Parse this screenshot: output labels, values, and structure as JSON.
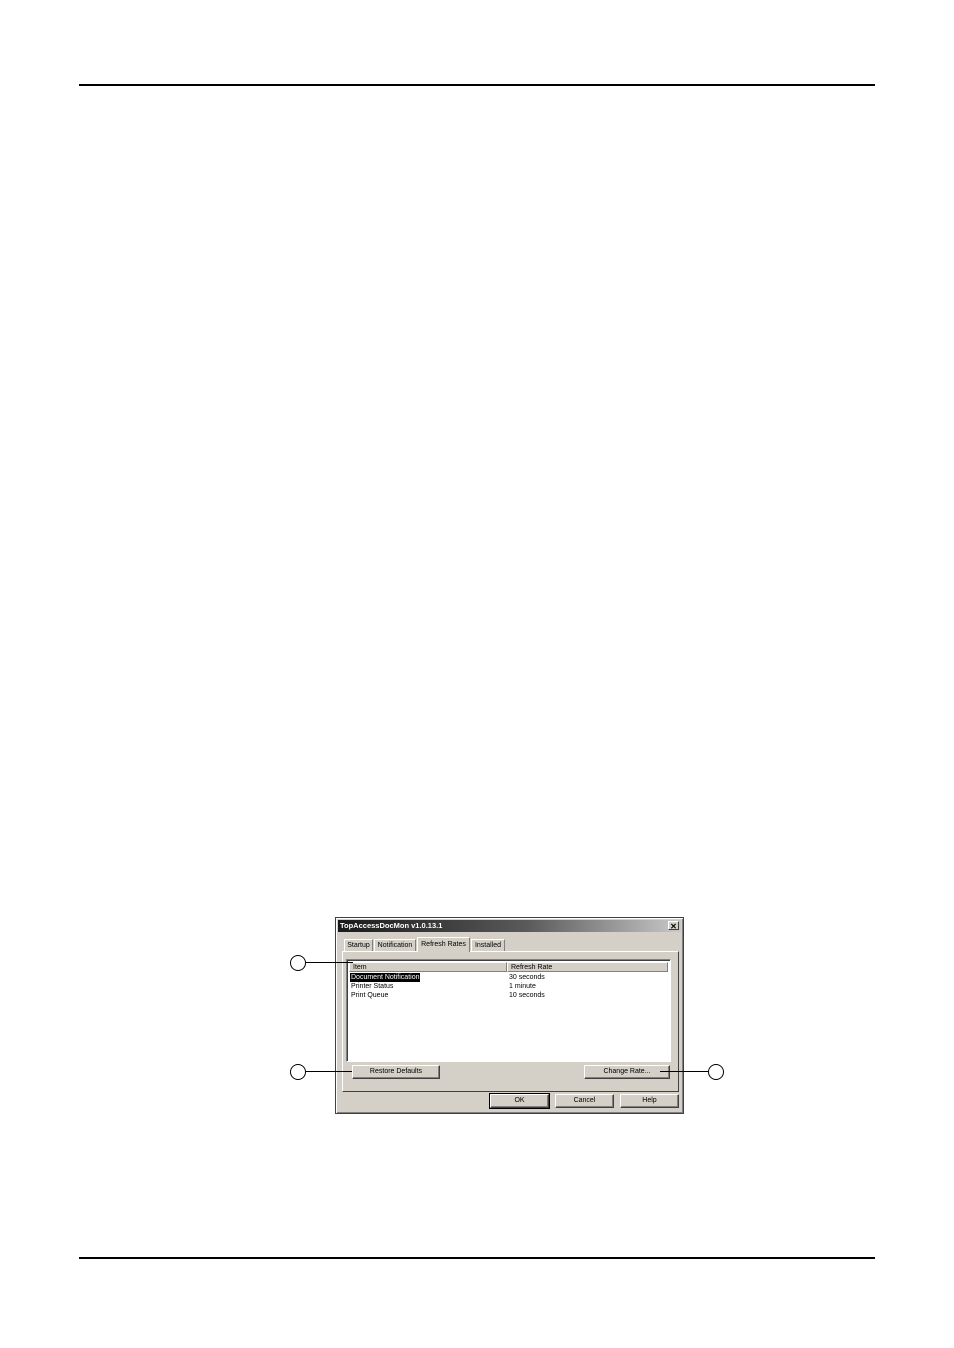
{
  "dialog": {
    "title": "TopAccessDocMon  v1.0.13.1",
    "close_glyph": "✕",
    "tabs": [
      {
        "label": "Startup"
      },
      {
        "label": "Notification"
      },
      {
        "label": "Refresh Rates"
      },
      {
        "label": "Installed"
      }
    ],
    "active_tab": "Refresh Rates",
    "list": {
      "columns": [
        "Item",
        "Refresh Rate"
      ],
      "rows": [
        {
          "item": "Document Notification",
          "rate": "30 seconds",
          "selected": true
        },
        {
          "item": "Printer Status",
          "rate": "1 minute",
          "selected": false
        },
        {
          "item": "Print Queue",
          "rate": "10 seconds",
          "selected": false
        }
      ]
    },
    "buttons": {
      "restore_defaults": "Restore Defaults",
      "change_rate": "Change Rate...",
      "ok": "OK",
      "cancel": "Cancel",
      "help": "Help"
    }
  },
  "callouts": [
    {
      "target": "refresh-rates-list"
    },
    {
      "target": "restore-defaults-button"
    },
    {
      "target": "change-rate-button"
    }
  ]
}
